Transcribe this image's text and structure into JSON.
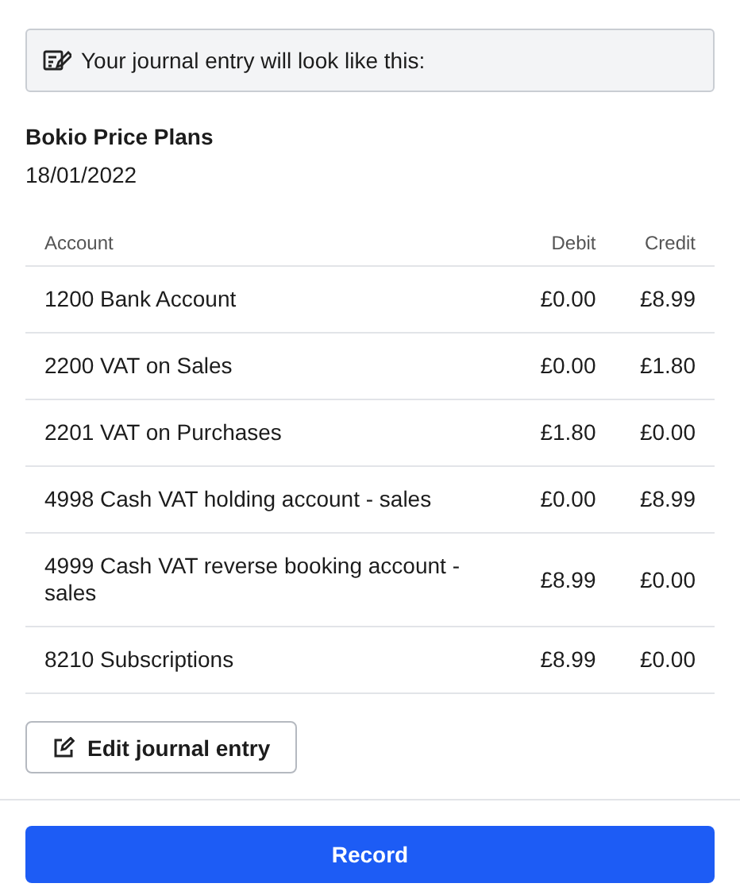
{
  "notice": {
    "text": "Your journal entry will look like this:"
  },
  "entry": {
    "title": "Bokio Price Plans",
    "date": "18/01/2022"
  },
  "table": {
    "columns": [
      "Account",
      "Debit",
      "Credit"
    ],
    "rows": [
      {
        "account": "1200 Bank Account",
        "debit": "£0.00",
        "credit": "£8.99"
      },
      {
        "account": "2200 VAT on Sales",
        "debit": "£0.00",
        "credit": "£1.80"
      },
      {
        "account": "2201 VAT on Purchases",
        "debit": "£1.80",
        "credit": "£0.00"
      },
      {
        "account": "4998 Cash VAT holding account - sales",
        "debit": "£0.00",
        "credit": "£8.99"
      },
      {
        "account": "4999 Cash VAT reverse booking account - sales",
        "debit": "£8.99",
        "credit": "£0.00"
      },
      {
        "account": "8210 Subscriptions",
        "debit": "£8.99",
        "credit": "£0.00"
      }
    ]
  },
  "edit_button": {
    "label": "Edit journal entry"
  },
  "record_button": {
    "label": "Record"
  }
}
